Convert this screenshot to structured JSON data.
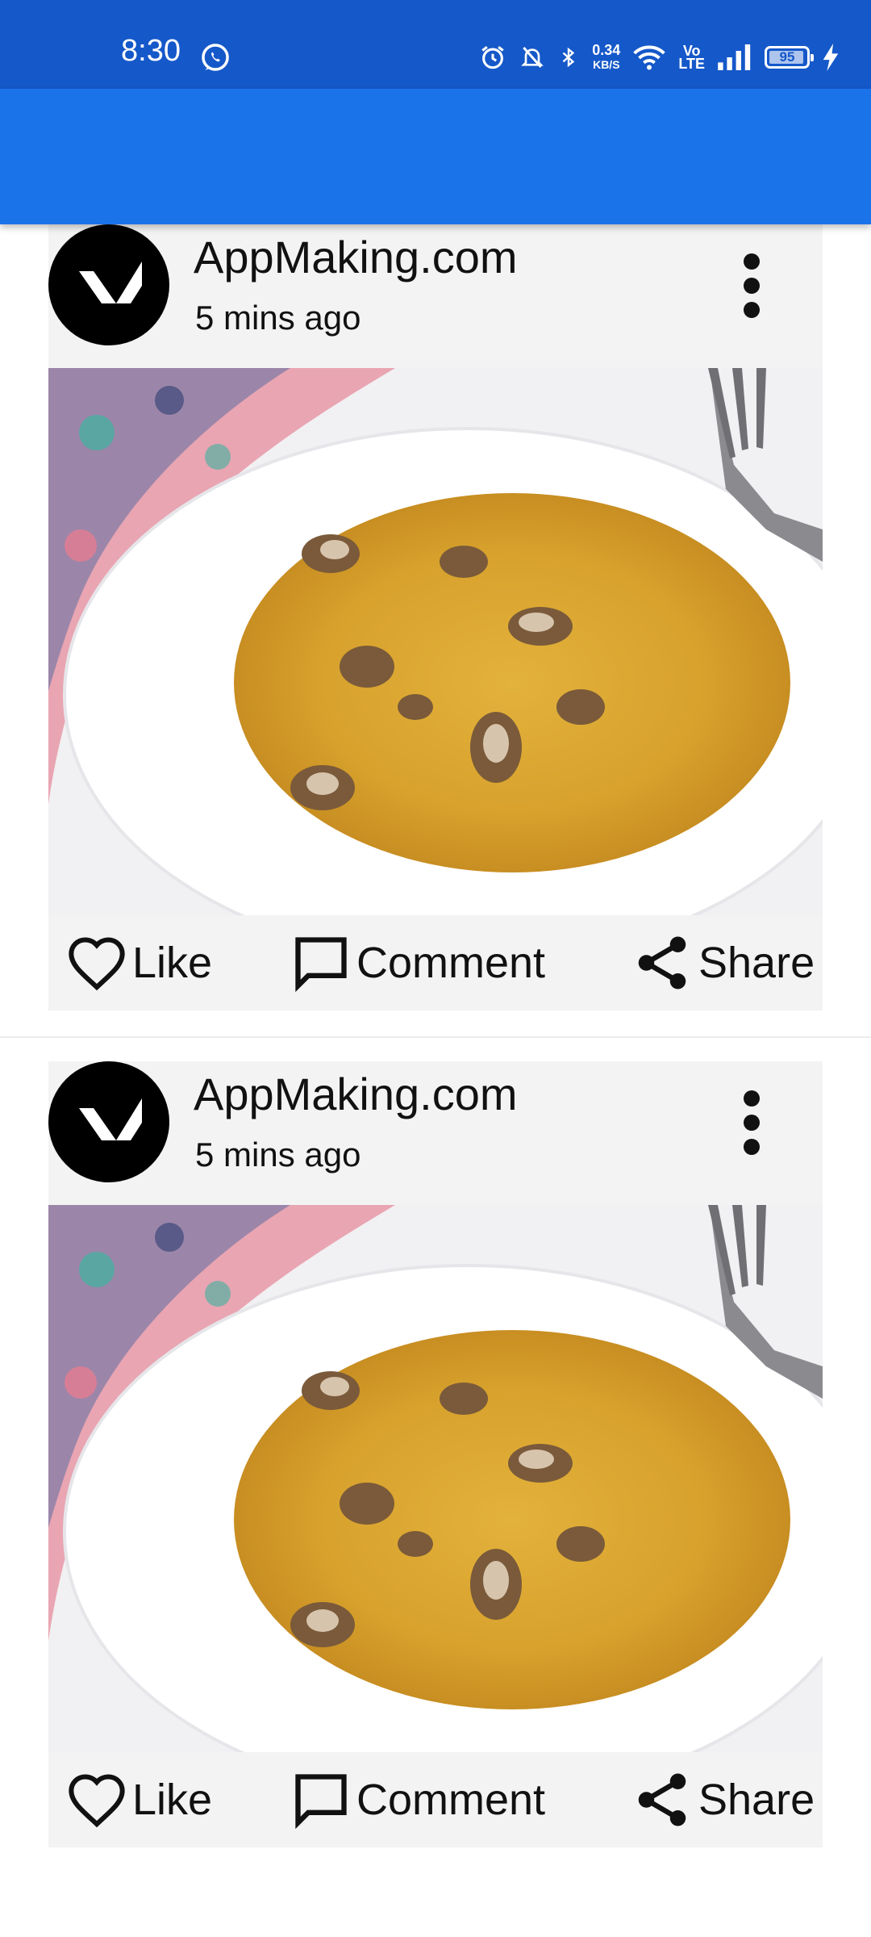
{
  "status_bar": {
    "time": "8:30",
    "net_speed_value": "0.34",
    "net_speed_unit": "KB/S",
    "volte_top": "Vo",
    "volte_bottom": "LTE",
    "battery_level": "95",
    "icons": [
      "whatsapp-icon",
      "alarm-icon",
      "mute-icon",
      "bluetooth-icon",
      "wifi-icon",
      "signal-icon",
      "battery-icon",
      "charging-icon"
    ]
  },
  "colors": {
    "status_bar": "#1558c9",
    "app_bar": "#1a73e9",
    "card_bg": "#f3f3f3"
  },
  "posts": [
    {
      "author": "AppMaking.com",
      "time": "5 mins ago",
      "actions": {
        "like": "Like",
        "comment": "Comment",
        "share": "Share"
      }
    },
    {
      "author": "AppMaking.com",
      "time": "5 mins ago",
      "actions": {
        "like": "Like",
        "comment": "Comment",
        "share": "Share"
      }
    }
  ]
}
